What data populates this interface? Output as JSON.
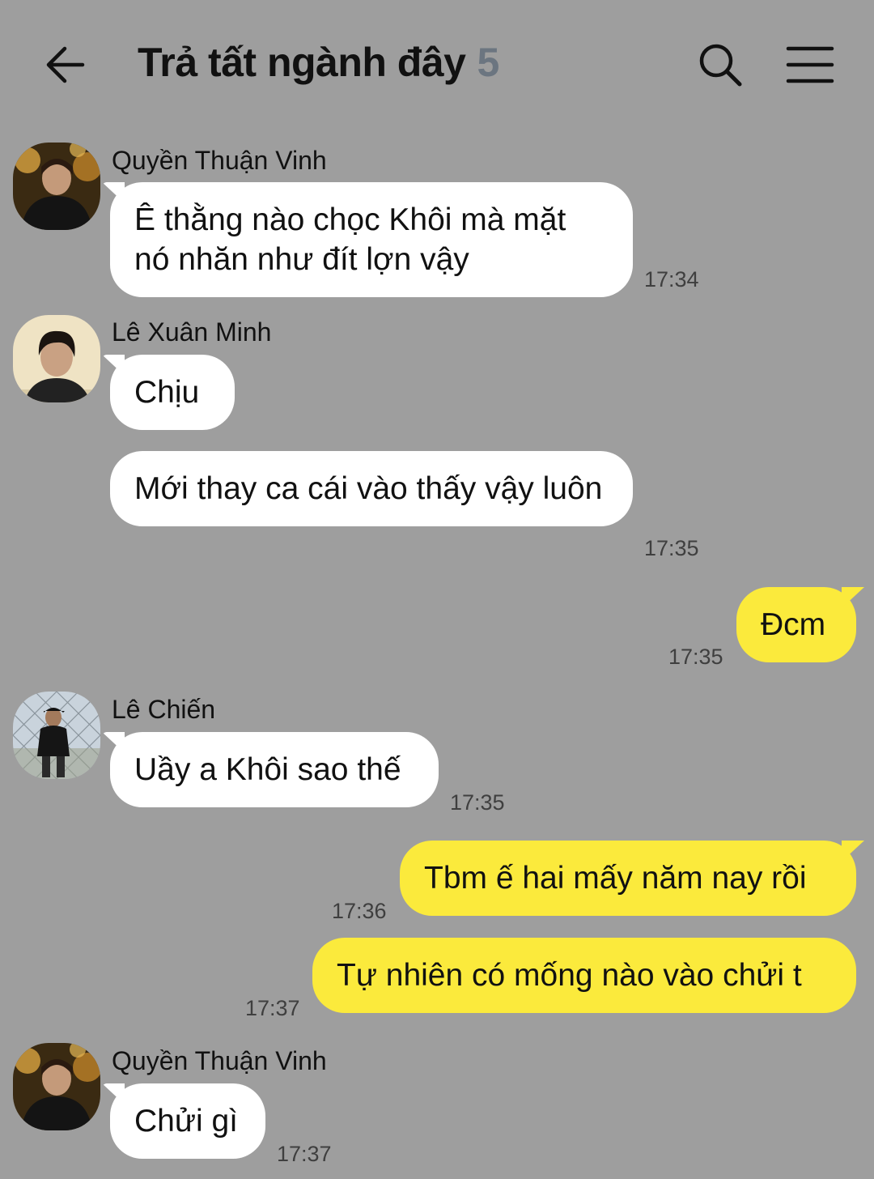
{
  "header": {
    "back_icon": "arrow-left-icon",
    "title": "Trả tất ngành đây",
    "member_count": "5",
    "search_icon": "search-icon",
    "menu_icon": "hamburger-menu-icon"
  },
  "colors": {
    "background": "#9e9e9e",
    "incoming_bubble": "#ffffff",
    "outgoing_bubble": "#fbea3c",
    "member_count": "#6b7580"
  },
  "messages": [
    {
      "sender": "Quyền Thuận Vinh",
      "text": "Ê thằng nào chọc Khôi mà mặt nó nhăn như đít lợn vậy",
      "time": "17:34"
    },
    {
      "sender": "Lê Xuân Minh",
      "text": "Chịu"
    },
    {
      "text": "Mới thay ca cái vào thấy vậy luôn",
      "time": "17:35"
    },
    {
      "text": "Đcm",
      "time": "17:35"
    },
    {
      "sender": "Lê Chiến",
      "text": "Uầy a Khôi sao thế",
      "time": "17:35"
    },
    {
      "text": "Tbm ế hai mấy năm nay rồi",
      "time": "17:36"
    },
    {
      "text": "Tự nhiên có mống nào vào chửi t",
      "time": "17:37"
    },
    {
      "sender": "Quyền Thuận Vinh",
      "text": "Chửi gì",
      "time": "17:37"
    }
  ]
}
